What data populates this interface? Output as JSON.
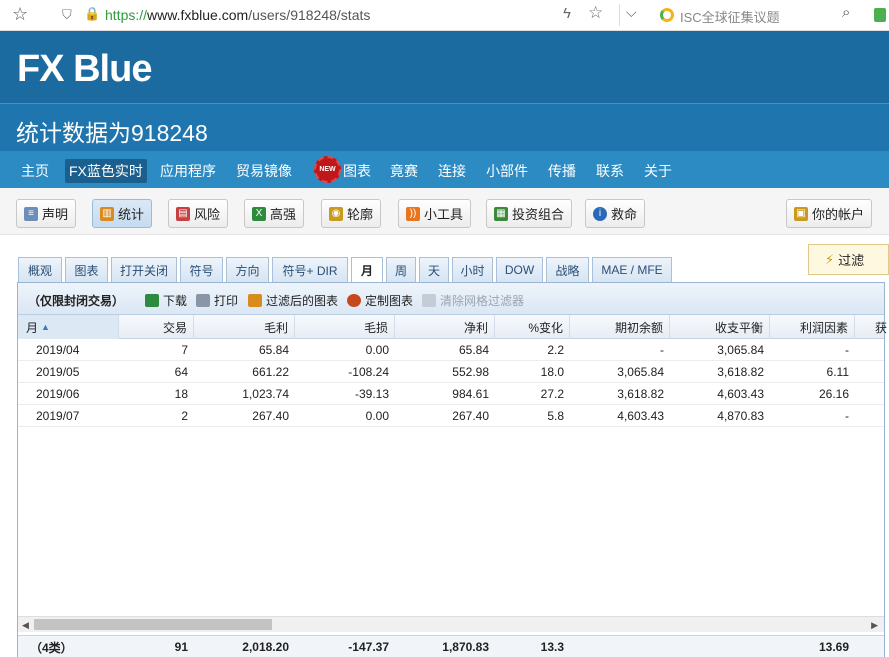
{
  "browser": {
    "url_scheme": "https://",
    "url_domain": "www.fxblue.com",
    "url_path": "/users/918248/stats",
    "search_text": "ISC全球征集议题"
  },
  "brand": {
    "logo": "FX Blue"
  },
  "page": {
    "title": "统计数据为918248"
  },
  "nav": {
    "items": [
      "主页",
      "FX蓝色实时",
      "应用程序",
      "贸易镜像",
      "图表",
      "竟赛",
      "连接",
      "小部件",
      "传播",
      "联系",
      "关于"
    ],
    "new_badge": "NEW"
  },
  "toolbar": {
    "buttons": [
      "声明",
      "统计",
      "风险",
      "高强",
      "轮廓",
      "小工具",
      "投资组合",
      "救命"
    ],
    "account": "你的帐户"
  },
  "filter": {
    "label": "过滤"
  },
  "tabs": [
    "概观",
    "图表",
    "打开关闭",
    "符号",
    "方向",
    "符号+ DIR",
    "月",
    "周",
    "天",
    "小时",
    "DOW",
    "战略",
    "MAE / MFE"
  ],
  "grid": {
    "title": "（仅限封闭交易）",
    "actions": [
      "下载",
      "打印",
      "过滤后的图表",
      "定制图表",
      "清除网格过滤器"
    ],
    "columns": [
      "月",
      "交易",
      "毛利",
      "毛损",
      "净利",
      "%变化",
      "期初余额",
      "收支平衡",
      "利润因素",
      "获"
    ],
    "rows": [
      [
        "2019/04",
        "7",
        "65.84",
        "0.00",
        "65.84",
        "2.2",
        "-",
        "3,065.84",
        "-"
      ],
      [
        "2019/05",
        "64",
        "661.22",
        "-108.24",
        "552.98",
        "18.0",
        "3,065.84",
        "3,618.82",
        "6.11"
      ],
      [
        "2019/06",
        "18",
        "1,023.74",
        "-39.13",
        "984.61",
        "27.2",
        "3,618.82",
        "4,603.43",
        "26.16"
      ],
      [
        "2019/07",
        "2",
        "267.40",
        "0.00",
        "267.40",
        "5.8",
        "4,603.43",
        "4,870.83",
        "-"
      ]
    ],
    "footer": [
      "（4类）",
      "91",
      "2,018.20",
      "-147.37",
      "1,870.83",
      "13.3",
      "",
      "",
      "13.69"
    ]
  }
}
